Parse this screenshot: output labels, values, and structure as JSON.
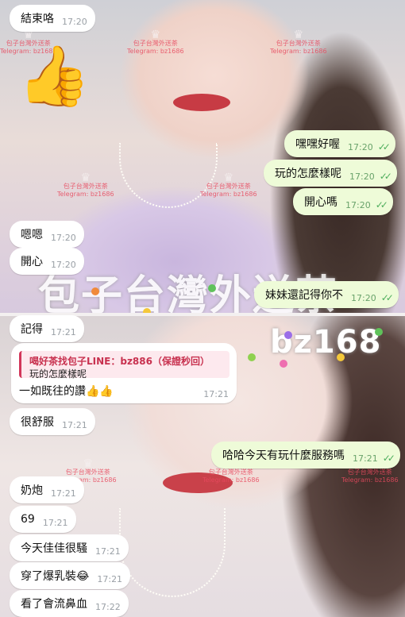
{
  "watermarks": {
    "main_text": "包子台灣外送茶",
    "handle": "bz168",
    "stamp_line1": "包子台灣外送茶",
    "stamp_line2": "Telegram: bz1686"
  },
  "sticker": "👍",
  "messages": [
    {
      "id": "m1",
      "dir": "in",
      "text": "結束咯",
      "time": "17:20"
    },
    {
      "id": "m2",
      "dir": "out",
      "text": "嘿嘿好喔",
      "time": "17:20"
    },
    {
      "id": "m3",
      "dir": "out",
      "text": "玩的怎麼樣呢",
      "time": "17:20"
    },
    {
      "id": "m4",
      "dir": "out",
      "text": "開心嗎",
      "time": "17:20"
    },
    {
      "id": "m5",
      "dir": "in",
      "text": "嗯嗯",
      "time": "17:20"
    },
    {
      "id": "m6",
      "dir": "in",
      "text": "開心",
      "time": "17:20"
    },
    {
      "id": "m7",
      "dir": "out",
      "text": "妹妹還記得你不",
      "time": "17:20"
    },
    {
      "id": "m8",
      "dir": "in",
      "text": "記得",
      "time": "17:21"
    },
    {
      "id": "m10",
      "dir": "in",
      "text": "很舒服",
      "time": "17:21"
    },
    {
      "id": "m11",
      "dir": "out",
      "text": "哈哈今天有玩什麼服務嗎",
      "time": "17:21"
    },
    {
      "id": "m12",
      "dir": "in",
      "text": "奶炮",
      "time": "17:21"
    },
    {
      "id": "m13",
      "dir": "in",
      "text": "69",
      "time": "17:21"
    },
    {
      "id": "m14",
      "dir": "in",
      "text": "今天佳佳很騷",
      "time": "17:21"
    },
    {
      "id": "m15",
      "dir": "in",
      "text": "穿了爆乳裝😂",
      "time": "17:21"
    },
    {
      "id": "m16",
      "dir": "in",
      "text": "看了會流鼻血",
      "time": "17:22"
    }
  ],
  "reply_message": {
    "quoted_author": "喝好茶找包子LINE：bz886（保證秒回）",
    "quoted_text": "玩的怎麼樣呢",
    "text": "一如既往的讚👍👍",
    "time": "17:21"
  },
  "colors": {
    "incoming_bubble": "#ffffff",
    "outgoing_bubble": "#eefbd8",
    "read_check": "#4fae5d",
    "quote_accent": "#d2365a"
  }
}
